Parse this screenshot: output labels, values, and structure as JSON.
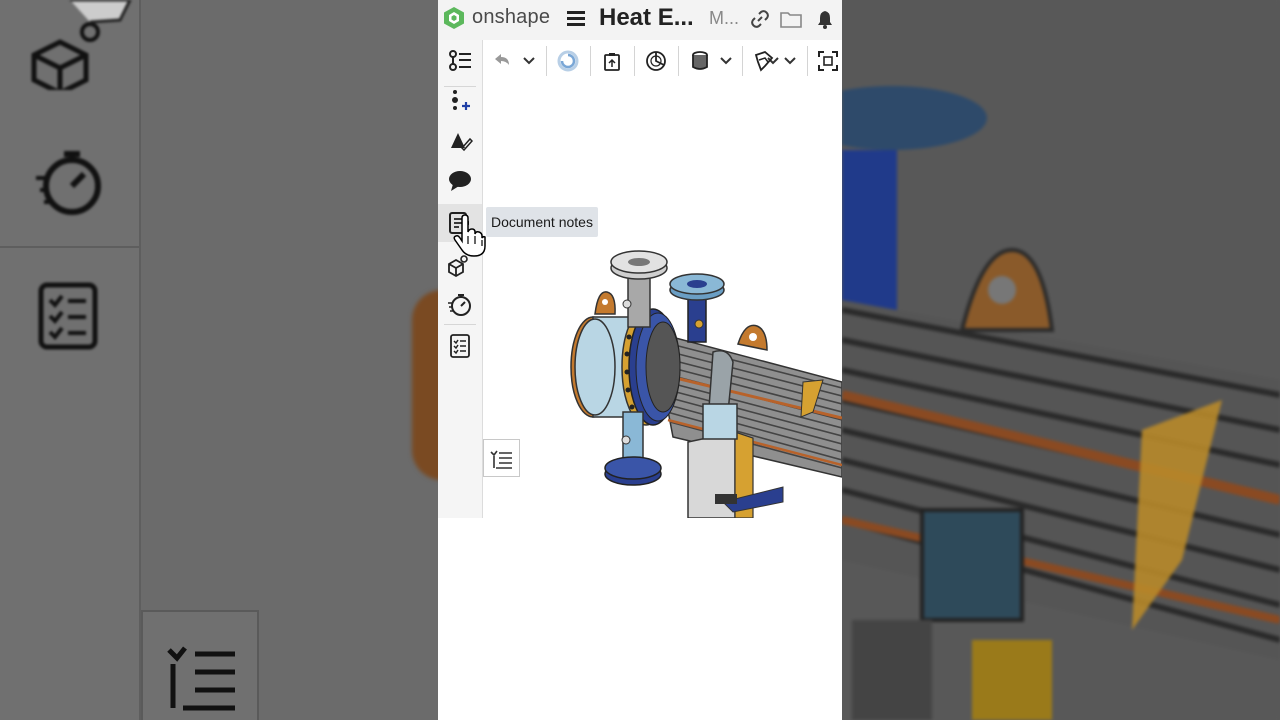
{
  "app": {
    "brand": "onshape",
    "document_title": "Heat E...",
    "workspace_label": "M..."
  },
  "topbar_icons": [
    "menu-icon",
    "link-icon",
    "folder-icon",
    "bell-icon"
  ],
  "toolbar": {
    "items": [
      "undo-icon",
      "chevron-down-icon",
      "regenerate-icon",
      "paste-icon",
      "section-view-icon",
      "render-mode-icon",
      "chevron-down-icon",
      "named-views-icon",
      "chevron-down-icon",
      "zoom-fit-icon"
    ]
  },
  "left_panel": {
    "items": [
      {
        "name": "feature-list-icon"
      },
      {
        "name": "insert-part-icon"
      },
      {
        "name": "appearance-icon"
      },
      {
        "name": "comments-icon"
      },
      {
        "name": "document-notes-icon"
      },
      {
        "name": "parts-icon"
      },
      {
        "name": "performance-icon"
      },
      {
        "name": "bill-of-materials-icon"
      }
    ]
  },
  "tooltip": {
    "text": "Document notes"
  },
  "colors": {
    "brand_green": "#4CAF50",
    "topbar_bg": "#f3f3f3",
    "tooltip_bg": "#dfe3e8",
    "steel_blue": "#2a3f8f",
    "copper": "#b8622a",
    "shell_light_blue": "#b9d6e4",
    "tube_gray": "#9a9a9a"
  }
}
